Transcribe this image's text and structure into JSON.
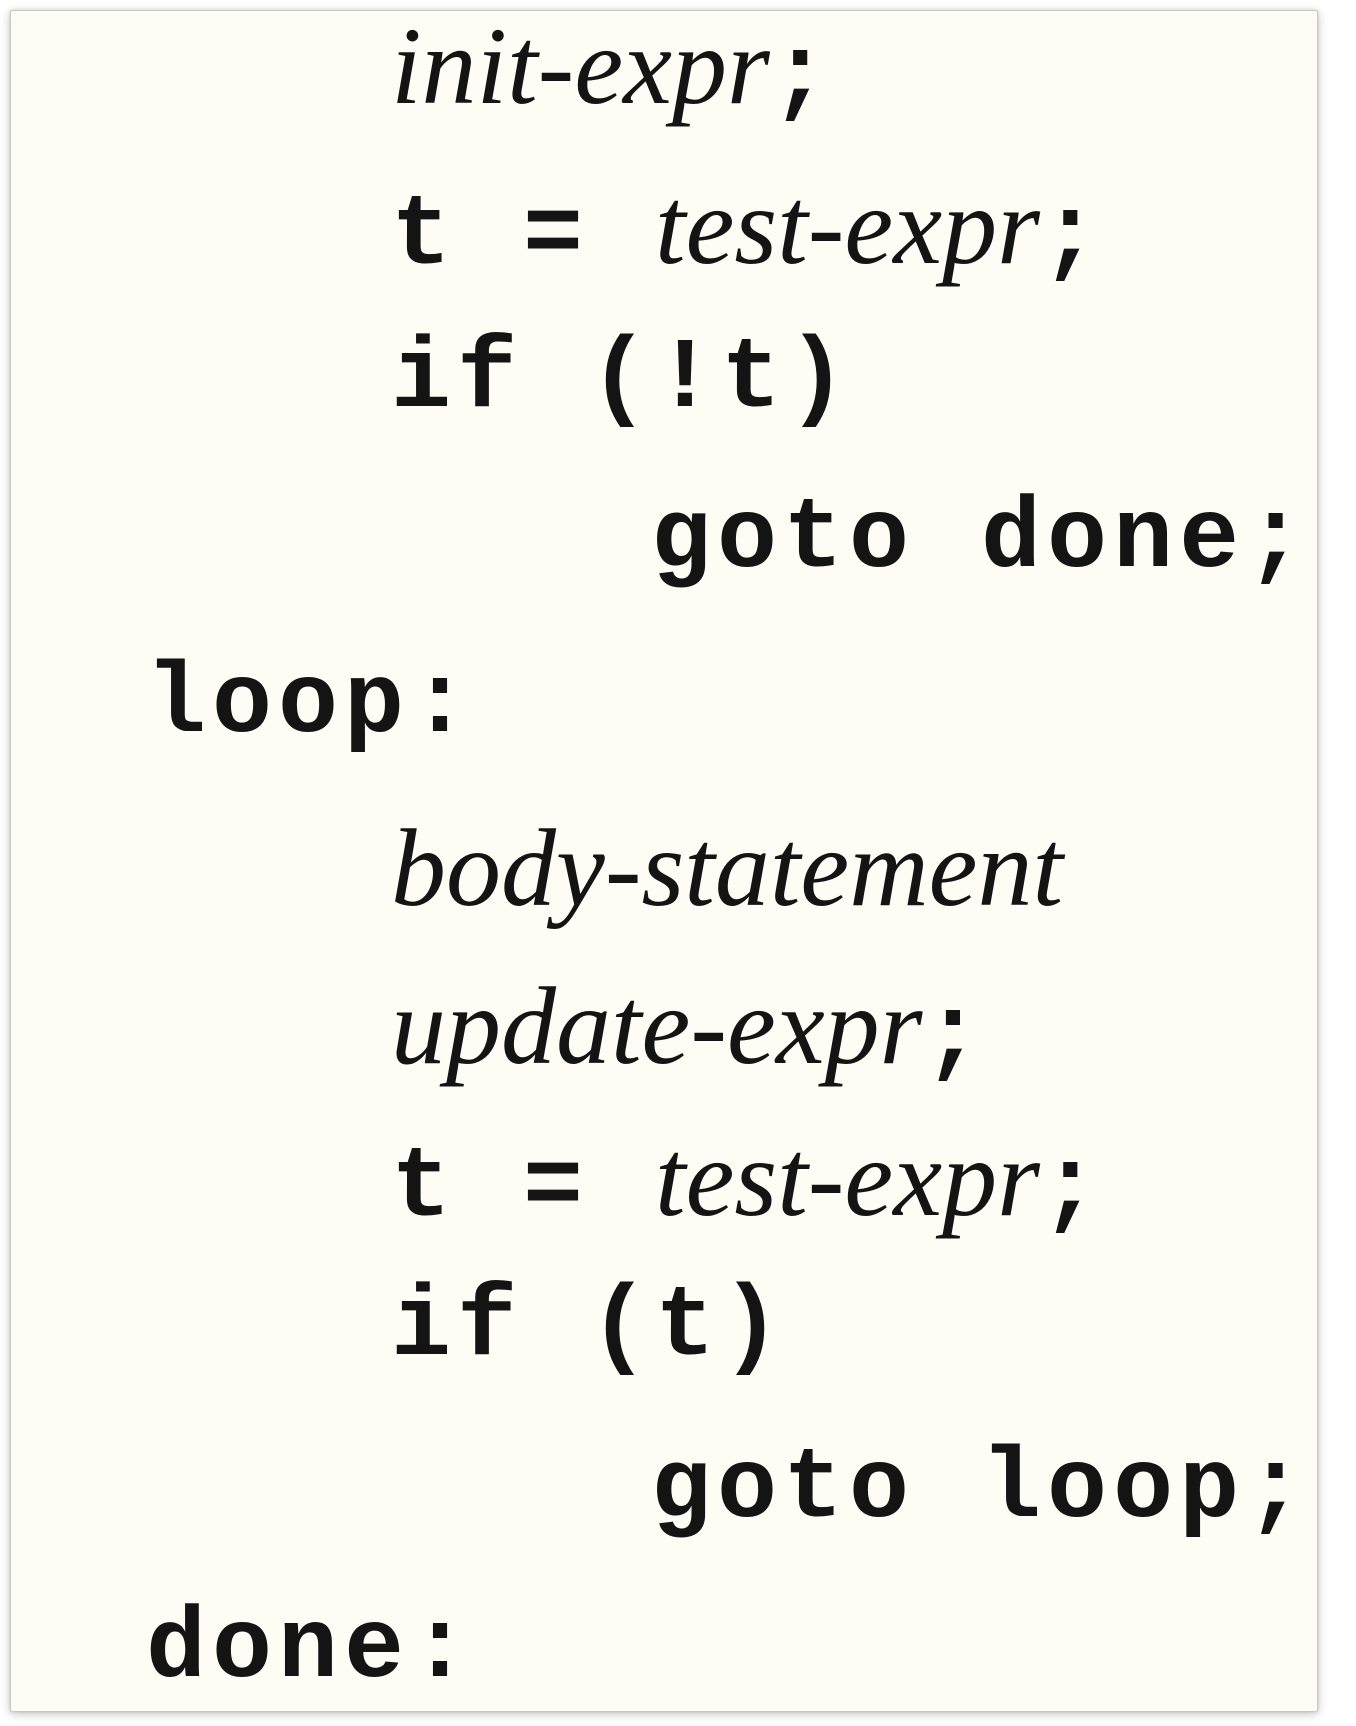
{
  "lines": [
    {
      "segments": [
        {
          "text": "init-expr",
          "style": "italic"
        },
        {
          "text": ";",
          "style": "mono"
        }
      ]
    },
    {
      "segments": [
        {
          "text": "t = ",
          "style": "mono"
        },
        {
          "text": "test-expr",
          "style": "italic"
        },
        {
          "text": ";",
          "style": "mono"
        }
      ]
    },
    {
      "segments": [
        {
          "text": "if (!t)",
          "style": "mono"
        }
      ]
    },
    {
      "segments": [
        {
          "text": "goto done;",
          "style": "mono"
        }
      ]
    },
    {
      "segments": [
        {
          "text": "loop:",
          "style": "mono"
        }
      ]
    },
    {
      "segments": [
        {
          "text": "body-statement",
          "style": "italic"
        }
      ]
    },
    {
      "segments": [
        {
          "text": "update-expr",
          "style": "italic"
        },
        {
          "text": ";",
          "style": "mono"
        }
      ]
    },
    {
      "segments": [
        {
          "text": "t = ",
          "style": "mono"
        },
        {
          "text": "test-expr",
          "style": "italic"
        },
        {
          "text": ";",
          "style": "mono"
        }
      ]
    },
    {
      "segments": [
        {
          "text": "if (t)",
          "style": "mono"
        }
      ]
    },
    {
      "segments": [
        {
          "text": "goto loop;",
          "style": "mono"
        }
      ]
    },
    {
      "segments": [
        {
          "text": "done:",
          "style": "mono"
        }
      ]
    }
  ]
}
